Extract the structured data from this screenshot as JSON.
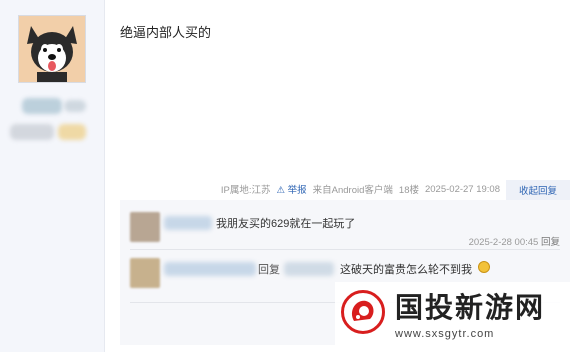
{
  "post": {
    "text": "绝逼内部人买的",
    "meta": {
      "ip": "IP属地:江苏",
      "report": "举报",
      "client": "来自Android客户端",
      "floor": "18楼",
      "time": "2025-02-27 19:08"
    },
    "fold_reply": "收起回复"
  },
  "replies": [
    {
      "text": "我朋友买的629就在一起玩了",
      "time": "2025-2-28 00:45",
      "reply_label": "回复"
    },
    {
      "reply_word": "回复",
      "text": "这破天的富贵怎么轮不到我"
    }
  ],
  "watermark": {
    "title": "国投新游网",
    "url": "www.sxsgytr.com"
  },
  "colors": {
    "accent": "#2d64b3",
    "watermark_red": "#d81e1e"
  }
}
